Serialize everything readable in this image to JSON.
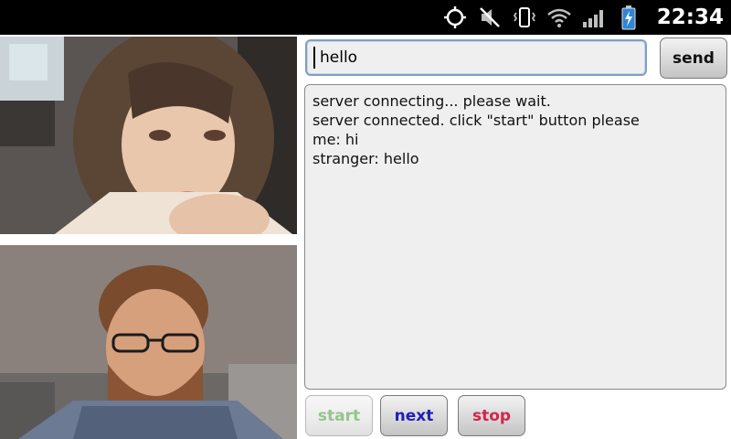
{
  "status_bar": {
    "time": "22:34",
    "icons": [
      "gps-icon",
      "mute-icon",
      "vibrate-icon",
      "wifi-icon",
      "signal-icon",
      "battery-charging-icon"
    ]
  },
  "chat": {
    "input_value": "hello",
    "send_label": "send",
    "log": [
      "server connecting... please wait.",
      "server connected. click \"start\" button please",
      "me: hi",
      "stranger: hello"
    ]
  },
  "controls": {
    "start_label": "start",
    "next_label": "next",
    "stop_label": "stop"
  },
  "colors": {
    "start": "#93c58a",
    "next": "#1f1fb8",
    "stop": "#d6234a",
    "input_border": "#7f9ec5"
  }
}
